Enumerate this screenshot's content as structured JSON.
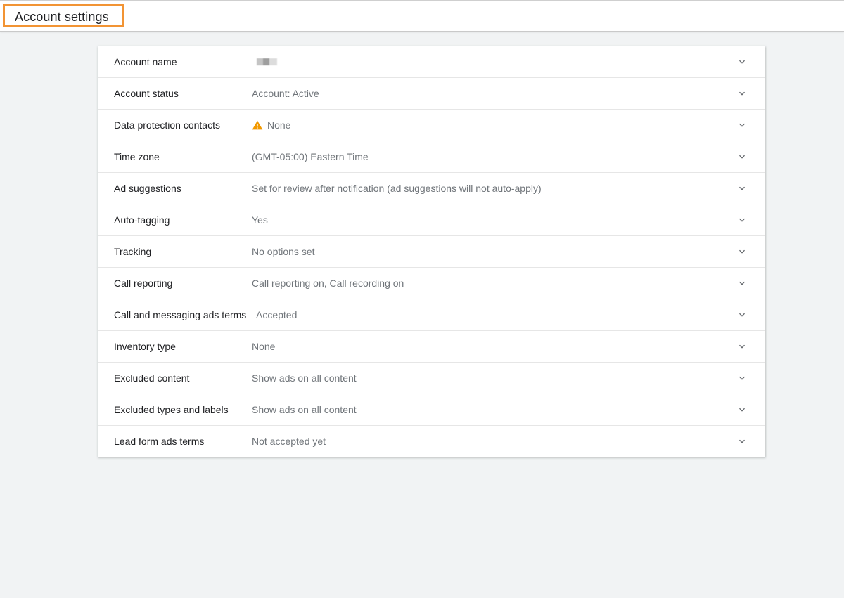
{
  "header": {
    "title": "Account settings",
    "highlight_color": "#f29434"
  },
  "settings": [
    {
      "label": "Account name",
      "value": "",
      "redacted": true
    },
    {
      "label": "Account status",
      "value": "Account: Active"
    },
    {
      "label": "Data protection contacts",
      "value": "None",
      "icon": "warning-icon",
      "icon_color": "#f29900"
    },
    {
      "label": "Time zone",
      "value": "(GMT-05:00) Eastern Time"
    },
    {
      "label": "Ad suggestions",
      "value": "Set for review after notification (ad suggestions will not auto-apply)"
    },
    {
      "label": "Auto-tagging",
      "value": "Yes"
    },
    {
      "label": "Tracking",
      "value": "No options set"
    },
    {
      "label": "Call reporting",
      "value": "Call reporting on, Call recording on"
    },
    {
      "label": "Call and messaging ads terms",
      "value": "Accepted"
    },
    {
      "label": "Inventory type",
      "value": "None"
    },
    {
      "label": "Excluded content",
      "value": "Show ads on all content"
    },
    {
      "label": "Excluded types and labels",
      "value": "Show ads on all content"
    },
    {
      "label": "Lead form ads terms",
      "value": "Not accepted yet"
    }
  ],
  "icons": {
    "expand": "chevron-down-icon"
  }
}
